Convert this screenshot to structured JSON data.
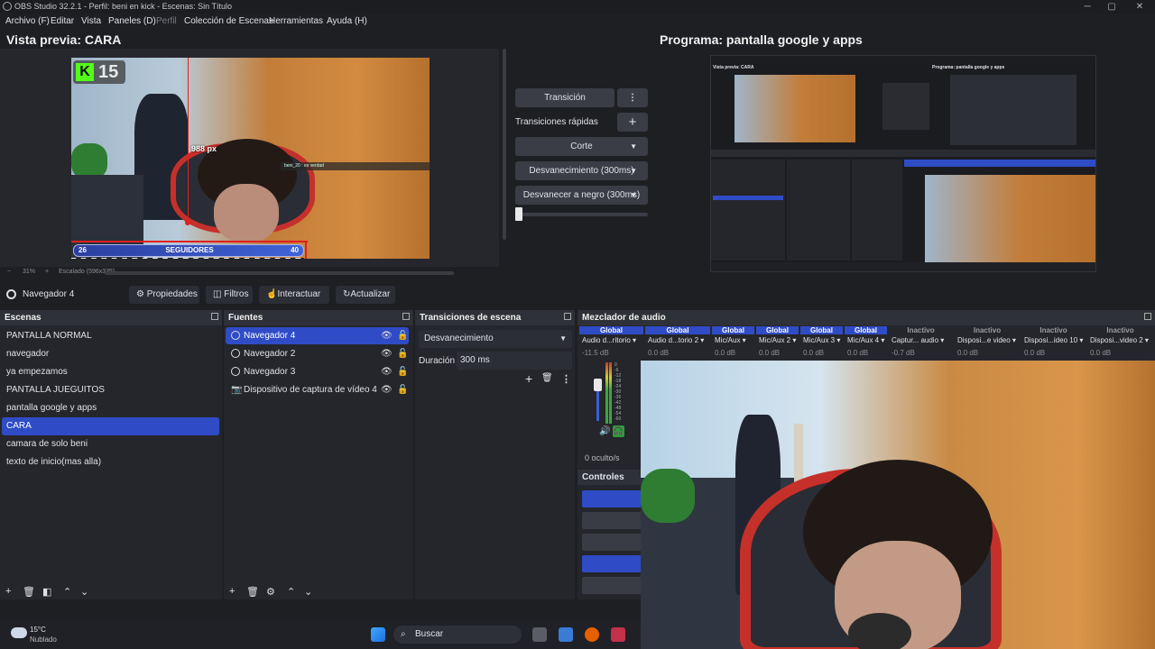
{
  "window": {
    "title": "OBS Studio 32.2.1 - Perfil: beni en kick - Escenas: Sin Título",
    "minimize": "─",
    "maximize": "▢",
    "close": "✕"
  },
  "menu": {
    "items": [
      "Archivo (F)",
      "Editar",
      "Vista",
      "Paneles (D)",
      "Perfil",
      "Colección de Escenas",
      "Herramientas",
      "Ayuda (H)"
    ]
  },
  "preview": {
    "title": "Vista previa: CARA",
    "kick_count": "15",
    "kick_letter": "K",
    "px_readout": "988 px",
    "followers_left": "26",
    "followers_label": "SEGUIDORES",
    "followers_right": "40",
    "chat_line": "beni_20 : es verdad",
    "zoom": "31%",
    "scale_label": "Escalado (596x335)",
    "zoom_minus": "−",
    "zoom_plus": "+"
  },
  "program": {
    "title": "Programa: pantalla google y apps",
    "nested_preview_title": "Vista previa: CARA",
    "nested_program_title": "Programa: pantalla google y apps"
  },
  "transition_panel": {
    "transition_button": "Transición",
    "more_icon": "⋮",
    "quick_transitions_label": "Transiciones rápidas",
    "add_icon": "+",
    "cut": "Corte",
    "fade": "Desvanecimiento (300ms)",
    "fade_black": "Desvanecer a negro (300ms)"
  },
  "toolbar": {
    "current_source": "Navegador 4",
    "properties": "Propiedades",
    "filters": "Filtros",
    "interact": "Interactuar",
    "refresh": "Actualizar"
  },
  "scenes": {
    "header": "Escenas",
    "items": [
      "PANTALLA NORMAL",
      "navegador",
      "ya empezamos",
      "PANTALLA JUEGUITOS",
      "pantalla google y apps",
      "CARA",
      "camara de solo beni",
      "texto de inicio(mas alla)"
    ],
    "selected_index": 5
  },
  "sources": {
    "header": "Fuentes",
    "items": [
      "Navegador 4",
      "Navegador 2",
      "Navegador 3",
      "Dispositivo de captura de vídeo 4"
    ],
    "selected_index": 0
  },
  "scene_transitions": {
    "header": "Transiciones de escena",
    "selected": "Desvanecimiento",
    "duration_label": "Duración",
    "duration_value": "300 ms"
  },
  "mixer": {
    "header": "Mezclador de audio",
    "hidden_label": "0 oculto/s",
    "channels": [
      {
        "status": "Global",
        "name": "Audio d...ritorio",
        "db": "-11.5 dB"
      },
      {
        "status": "Global",
        "name": "Audio d...torio 2",
        "db": "0.0 dB"
      },
      {
        "status": "Global",
        "name": "Mic/Aux",
        "db": "0.0 dB"
      },
      {
        "status": "Global",
        "name": "Mic/Aux 2",
        "db": "0.0 dB"
      },
      {
        "status": "Global",
        "name": "Mic/Aux 3",
        "db": "0.0 dB"
      },
      {
        "status": "Global",
        "name": "Mic/Aux 4",
        "db": "0.0 dB"
      },
      {
        "status": "Inactivo",
        "name": "Captur... audio",
        "db": "-0.7 dB"
      },
      {
        "status": "Inactivo",
        "name": "Disposi...e video",
        "db": "0.0 dB"
      },
      {
        "status": "Inactivo",
        "name": "Disposi...ideo 10",
        "db": "0.0 dB"
      },
      {
        "status": "Inactivo",
        "name": "Disposi...video 2",
        "db": "0.0 dB"
      }
    ],
    "scale": [
      "0",
      "-6",
      "-12",
      "-18",
      "-24",
      "-30",
      "-36",
      "-42",
      "-48",
      "-54",
      "-60"
    ]
  },
  "controls": {
    "header": "Controles"
  },
  "taskbar": {
    "temperature": "15°C",
    "weather": "Nublado",
    "search": "Buscar"
  },
  "colors": {
    "accent": "#2f4cc6",
    "kick_green": "#53fc18",
    "selection_red": "#e02020",
    "panel_bg": "#25262b"
  }
}
